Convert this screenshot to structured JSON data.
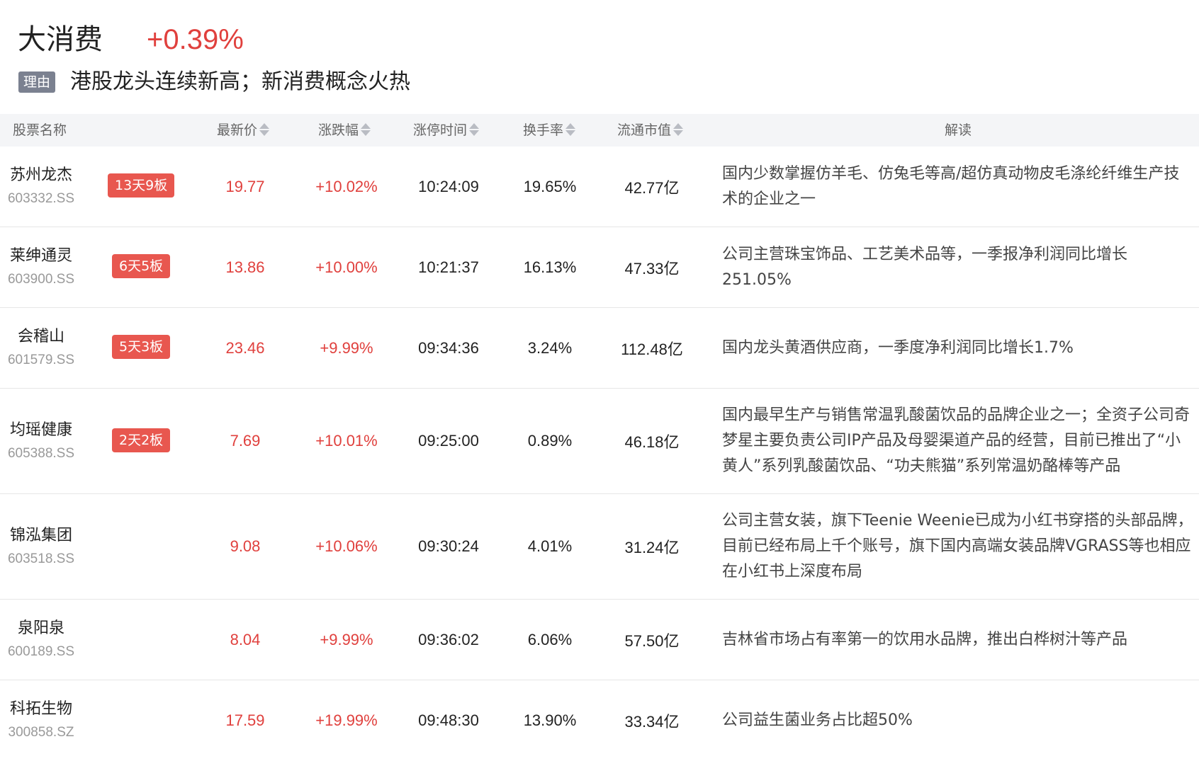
{
  "header": {
    "sector_name": "大消费",
    "sector_change": "+0.39%",
    "reason_tag": "理由",
    "reason_text": "港股龙头连续新高；新消费概念火热"
  },
  "table": {
    "columns": {
      "name": "股票名称",
      "price": "最新价",
      "change": "涨跌幅",
      "limit_time": "涨停时间",
      "turnover": "换手率",
      "market_cap": "流通市值",
      "analysis": "解读"
    },
    "rows": [
      {
        "name": "苏州龙杰",
        "code": "603332.SS",
        "badge": "13天9板",
        "price": "19.77",
        "change": "+10.02%",
        "limit_time": "10:24:09",
        "turnover": "19.65%",
        "market_cap": "42.77亿",
        "analysis": "国内少数掌握仿羊毛、仿兔毛等高/超仿真动物皮毛涤纶纤维生产技术的企业之一"
      },
      {
        "name": "莱绅通灵",
        "code": "603900.SS",
        "badge": "6天5板",
        "price": "13.86",
        "change": "+10.00%",
        "limit_time": "10:21:37",
        "turnover": "16.13%",
        "market_cap": "47.33亿",
        "analysis": "公司主营珠宝饰品、工艺美术品等，一季报净利润同比增长251.05%"
      },
      {
        "name": "会稽山",
        "code": "601579.SS",
        "badge": "5天3板",
        "price": "23.46",
        "change": "+9.99%",
        "limit_time": "09:34:36",
        "turnover": "3.24%",
        "market_cap": "112.48亿",
        "analysis": "国内龙头黄酒供应商，一季度净利润同比增长1.7%"
      },
      {
        "name": "均瑶健康",
        "code": "605388.SS",
        "badge": "2天2板",
        "price": "7.69",
        "change": "+10.01%",
        "limit_time": "09:25:00",
        "turnover": "0.89%",
        "market_cap": "46.18亿",
        "analysis": "国内最早生产与销售常温乳酸菌饮品的品牌企业之一；全资子公司奇梦星主要负责公司IP产品及母婴渠道产品的经营，目前已推出了“小黄人”系列乳酸菌饮品、“功夫熊猫”系列常温奶酪棒等产品"
      },
      {
        "name": "锦泓集团",
        "code": "603518.SS",
        "badge": "",
        "price": "9.08",
        "change": "+10.06%",
        "limit_time": "09:30:24",
        "turnover": "4.01%",
        "market_cap": "31.24亿",
        "analysis": "公司主营女装，旗下Teenie Weenie已成为小红书穿搭的头部品牌，目前已经布局上千个账号，旗下国内高端女装品牌VGRASS等也相应在小红书上深度布局"
      },
      {
        "name": "泉阳泉",
        "code": "600189.SS",
        "badge": "",
        "price": "8.04",
        "change": "+9.99%",
        "limit_time": "09:36:02",
        "turnover": "6.06%",
        "market_cap": "57.50亿",
        "analysis": "吉林省市场占有率第一的饮用水品牌，推出白桦树汁等产品"
      },
      {
        "name": "科拓生物",
        "code": "300858.SZ",
        "badge": "",
        "price": "17.59",
        "change": "+19.99%",
        "limit_time": "09:48:30",
        "turnover": "13.90%",
        "market_cap": "33.34亿",
        "analysis": "公司益生菌业务占比超50%"
      }
    ]
  },
  "colors": {
    "up": "#e0403d",
    "badge": "#e8574f",
    "tag": "#7b8190",
    "header_bg": "#f4f5f7"
  }
}
